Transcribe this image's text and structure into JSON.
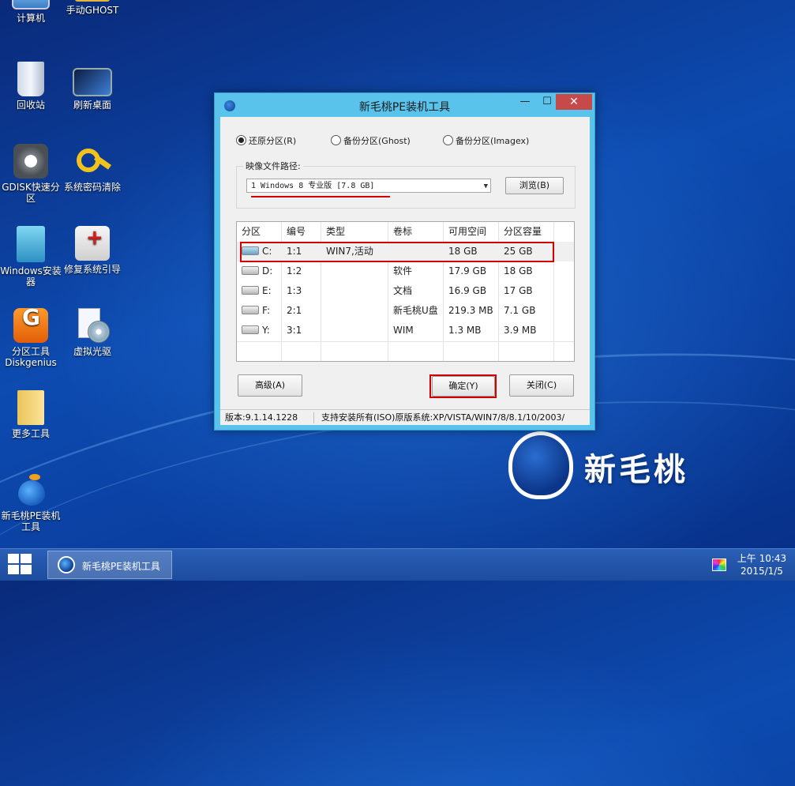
{
  "desktop": {
    "icons": [
      {
        "label": "计算机"
      },
      {
        "label": "手动GHOST"
      },
      {
        "label": "回收站"
      },
      {
        "label": "刷新桌面"
      },
      {
        "label": "GDISK快速分区"
      },
      {
        "label": "系统密码清除"
      },
      {
        "label": "Windows安装器"
      },
      {
        "label": "修复系统引导"
      },
      {
        "label": "分区工具Diskgenius"
      },
      {
        "label": "虚拟光驱"
      },
      {
        "label": "更多工具"
      },
      {
        "label": "新毛桃PE装机工具"
      }
    ],
    "logo_text": "新毛桃"
  },
  "dialog": {
    "title": "新毛桃PE装机工具",
    "title_buttons": {
      "minimize": "—",
      "maximize": "☐",
      "close": "✕"
    },
    "radios": [
      {
        "label": "还原分区(R)",
        "checked": true
      },
      {
        "label": "备份分区(Ghost)",
        "checked": false
      },
      {
        "label": "备份分区(Imagex)",
        "checked": false
      }
    ],
    "image_path_label": "映像文件路径:",
    "image_selected": "1 Windows 8 专业版 [7.8 GB]",
    "browse_label": "浏览(B)",
    "table": {
      "columns": [
        "分区",
        "编号",
        "类型",
        "卷标",
        "可用空间",
        "分区容量"
      ],
      "rows": [
        {
          "part": "C:",
          "num": "1:1",
          "type": "WIN7,活动",
          "label": "",
          "free": "18 GB",
          "size": "25 GB",
          "selected": true
        },
        {
          "part": "D:",
          "num": "1:2",
          "type": "",
          "label": "软件",
          "free": "17.9 GB",
          "size": "18 GB",
          "selected": false
        },
        {
          "part": "E:",
          "num": "1:3",
          "type": "",
          "label": "文档",
          "free": "16.9 GB",
          "size": "17 GB",
          "selected": false
        },
        {
          "part": "F:",
          "num": "2:1",
          "type": "",
          "label": "新毛桃U盘",
          "free": "219.3 MB",
          "size": "7.1 GB",
          "selected": false
        },
        {
          "part": "Y:",
          "num": "3:1",
          "type": "",
          "label": "WIM",
          "free": "1.3 MB",
          "size": "3.9 MB",
          "selected": false
        }
      ]
    },
    "advanced_label": "高级(A)",
    "ok_label": "确定(Y)",
    "close_label": "关闭(C)",
    "status_version": "版本:9.1.14.1228",
    "status_support": "支持安装所有(ISO)原版系统:XP/VISTA/WIN7/8/8.1/10/2003/"
  },
  "taskbar": {
    "task_label": "新毛桃PE装机工具",
    "clock_time": "上午 10:43",
    "clock_date": "2015/1/5"
  }
}
